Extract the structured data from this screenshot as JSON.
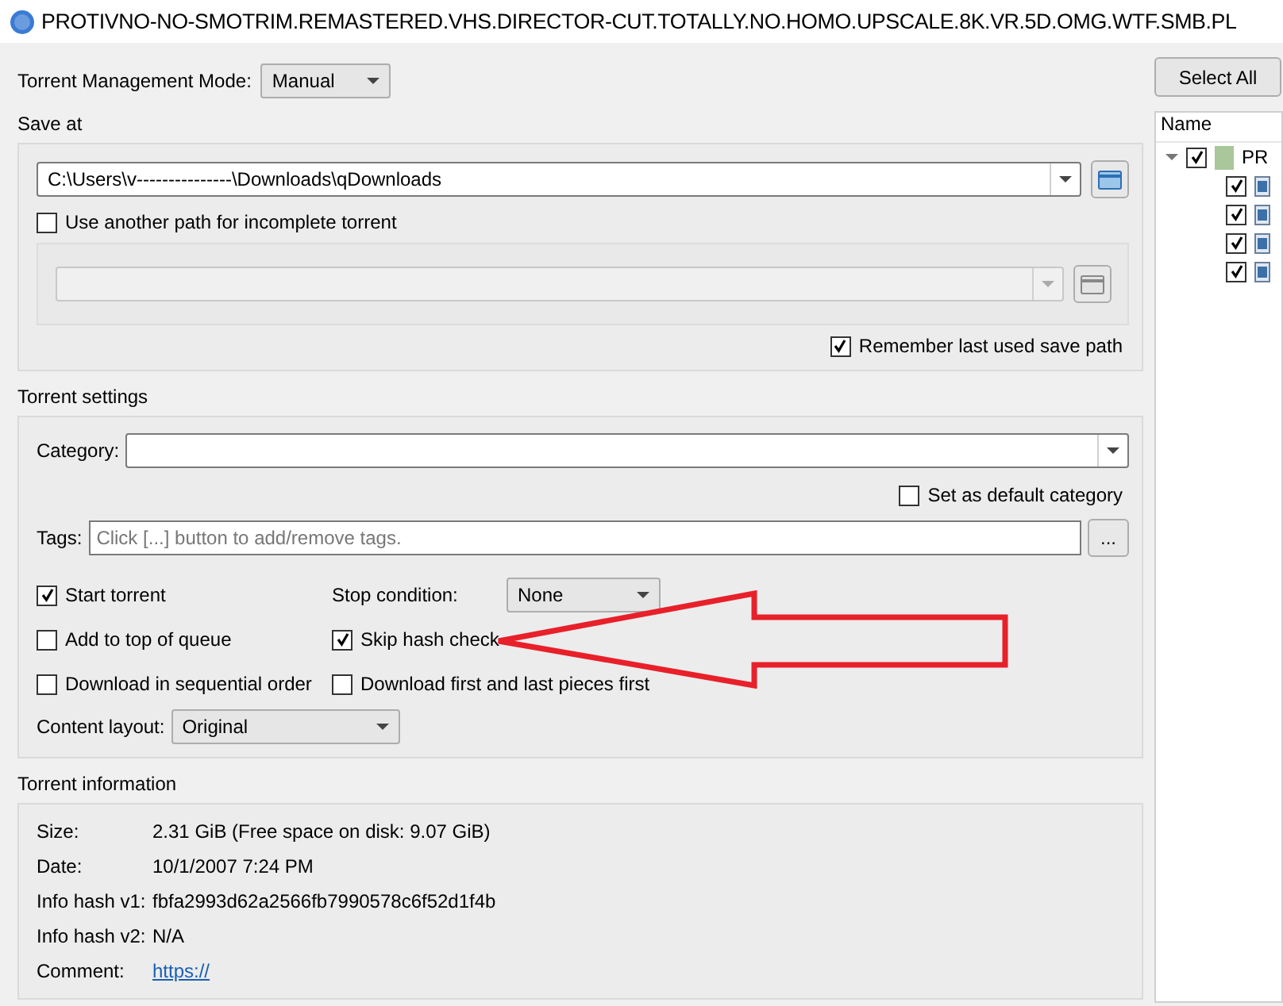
{
  "window": {
    "title": "PROTIVNO-NO-SMOTRIM.REMASTERED.VHS.DIRECTOR-CUT.TOTALLY.NO.HOMO.UPSCALE.8K.VR.5D.OMG.WTF.SMB.PL"
  },
  "management_mode": {
    "label": "Torrent Management Mode:",
    "value": "Manual"
  },
  "save_at": {
    "title": "Save at",
    "path": "C:\\Users\\v---------------\\Downloads\\qDownloads",
    "incomplete_path": {
      "label": "Use another path for incomplete torrent",
      "checked": false,
      "disabled": true
    },
    "remember": {
      "label": "Remember last used save path",
      "checked": true
    }
  },
  "torrent_settings": {
    "title": "Torrent settings",
    "category_label": "Category:",
    "default_category": {
      "label": "Set as default category",
      "checked": false
    },
    "tags_label": "Tags:",
    "tags_placeholder": "Click [...] button to add/remove tags.",
    "tags_button": "...",
    "options": [
      {
        "label": "Start torrent",
        "checked": true
      },
      {
        "label": "Add to top of queue",
        "checked": false
      },
      {
        "label": "Download in sequential order",
        "checked": false
      }
    ],
    "stop_condition": {
      "label": "Stop condition:",
      "value": "None"
    },
    "options_2": [
      {
        "label": "Skip hash check",
        "checked": true
      },
      {
        "label": "Download first and last pieces first",
        "checked": false
      }
    ],
    "content_layout": {
      "label": "Content layout:",
      "value": "Original"
    }
  },
  "torrent_information": {
    "title": "Torrent information",
    "rows": [
      {
        "label": "Size:",
        "value": "2.31 GiB (Free space on disk: 9.07 GiB)",
        "kind": "text"
      },
      {
        "label": "Date:",
        "value": "10/1/2007 7:24 PM",
        "kind": "text"
      },
      {
        "label": "Info hash v1:",
        "value": "fbfa2993d62a2566fb7990578c6f52d1f4b",
        "kind": "text"
      },
      {
        "label": "Info hash v2:",
        "value": "N/A",
        "kind": "text"
      },
      {
        "label": "Comment:",
        "value": "https://",
        "kind": "link"
      }
    ]
  },
  "file_panel": {
    "select_all": "Select All",
    "column": "Name",
    "tree": [
      {
        "name": "PR",
        "checked": true,
        "expanded": true,
        "children": [
          {
            "checked": true
          },
          {
            "checked": true
          },
          {
            "checked": true
          },
          {
            "checked": true
          }
        ]
      }
    ]
  }
}
